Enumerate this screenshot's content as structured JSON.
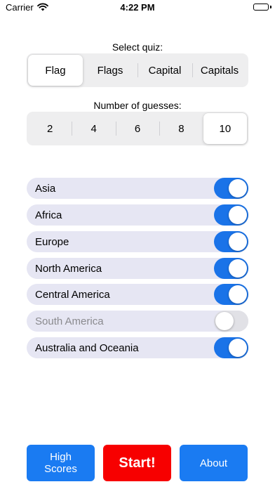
{
  "status_bar": {
    "carrier": "Carrier",
    "time": "4:22 PM"
  },
  "quiz_select": {
    "label": "Select quiz:",
    "options": [
      "Flag",
      "Flags",
      "Capital",
      "Capitals"
    ],
    "selected_index": 0
  },
  "guesses": {
    "label": "Number of guesses:",
    "options": [
      "2",
      "4",
      "6",
      "8",
      "10"
    ],
    "selected_index": 4
  },
  "regions": [
    {
      "label": "Asia",
      "enabled": true
    },
    {
      "label": "Africa",
      "enabled": true
    },
    {
      "label": "Europe",
      "enabled": true
    },
    {
      "label": "North America",
      "enabled": true
    },
    {
      "label": "Central America",
      "enabled": true
    },
    {
      "label": "South America",
      "enabled": false
    },
    {
      "label": "Australia and Oceania",
      "enabled": true
    }
  ],
  "buttons": {
    "high_scores_line1": "High",
    "high_scores_line2": "Scores",
    "start": "Start!",
    "about": "About"
  },
  "colors": {
    "accent_blue": "#1a7bf2",
    "start_red": "#f70000",
    "toggle_on": "#1a73e8",
    "row_background": "#e6e6f3"
  }
}
